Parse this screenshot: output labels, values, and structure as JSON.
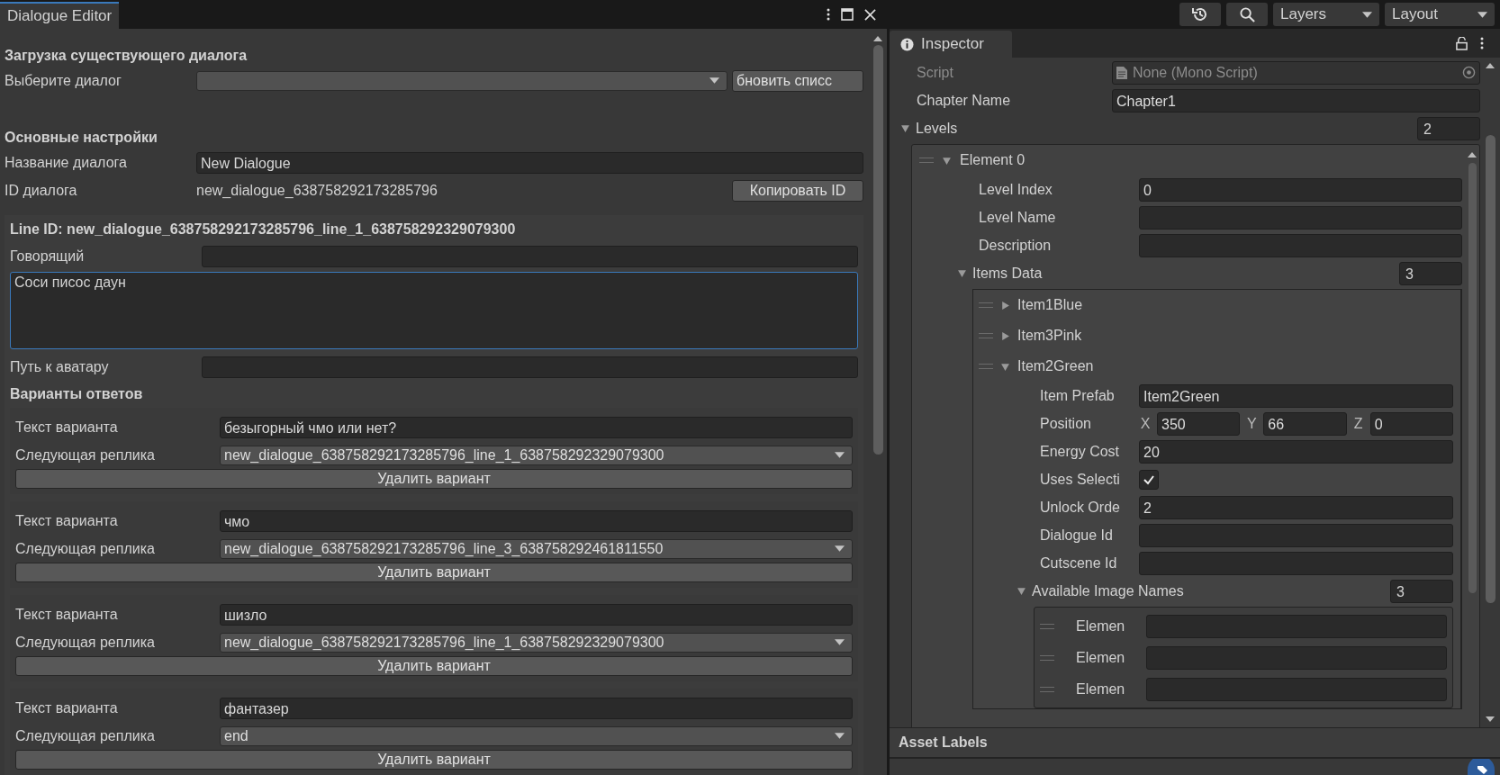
{
  "dialogue_editor": {
    "tab": "Dialogue Editor",
    "load": {
      "heading": "Загрузка существующего диалога",
      "select_label": "Выберите диалог",
      "refresh_button": "бновить списс"
    },
    "settings": {
      "heading": "Основные настройки",
      "name_label": "Название диалога",
      "name_value": "New Dialogue",
      "id_label": "ID диалога",
      "id_value": "new_dialogue_638758292173285796",
      "copy_button": "Копировать ID"
    },
    "line": {
      "title": "Line ID: new_dialogue_638758292173285796_line_1_638758292329079300",
      "speaker_label": "Говорящий",
      "text": "Соси писос даун",
      "avatar_label": "Путь к аватару",
      "variants_heading": "Варианты ответов",
      "variants": [
        {
          "text_label": "Текст варианта",
          "text": "безыгорный чмо или нет?",
          "next_label": "Следующая реплика",
          "next": "new_dialogue_638758292173285796_line_1_638758292329079300",
          "delete_button": "Удалить вариант"
        },
        {
          "text_label": "Текст варианта",
          "text": "чмо",
          "next_label": "Следующая реплика",
          "next": "new_dialogue_638758292173285796_line_3_638758292461811550",
          "delete_button": "Удалить вариант"
        },
        {
          "text_label": "Текст варианта",
          "text": "шизло",
          "next_label": "Следующая реплика",
          "next": "new_dialogue_638758292173285796_line_1_638758292329079300",
          "delete_button": "Удалить вариант"
        },
        {
          "text_label": "Текст варианта",
          "text": "фантазер",
          "next_label": "Следующая реплика",
          "next": "end",
          "delete_button": "Удалить вариант"
        }
      ]
    }
  },
  "toolbar": {
    "layers": "Layers",
    "layout": "Layout"
  },
  "inspector": {
    "tab": "Inspector",
    "script": {
      "label": "Script",
      "value": "None (Mono Script)"
    },
    "chapter": {
      "label": "Chapter Name",
      "value": "Chapter1"
    },
    "levels": {
      "label": "Levels",
      "count": "2",
      "expanded": true,
      "elements": [
        {
          "label": "Element 0",
          "expanded": true,
          "fields": [
            {
              "label": "Level Index",
              "value": "0"
            },
            {
              "label": "Level Name"
            },
            {
              "label": "Description"
            }
          ],
          "items_data": {
            "label": "Items Data",
            "count": "3",
            "expanded": true,
            "items": [
              {
                "name": "Item1Blue",
                "expanded": false
              },
              {
                "name": "Item3Pink",
                "expanded": false
              },
              {
                "name": "Item2Green",
                "expanded": true,
                "fields": [
                  {
                    "kind": "text",
                    "label": "Item Prefab",
                    "value": "Item2Green"
                  },
                  {
                    "kind": "vector",
                    "label": "Position",
                    "components": [
                      {
                        "axis": "X",
                        "value": "350"
                      },
                      {
                        "axis": "Y",
                        "value": "66"
                      },
                      {
                        "axis": "Z",
                        "value": "0"
                      }
                    ]
                  },
                  {
                    "kind": "text",
                    "label": "Energy Cost",
                    "value": "20"
                  },
                  {
                    "kind": "checkbox",
                    "label": "Uses Selecti",
                    "checked": true
                  },
                  {
                    "kind": "text",
                    "label": "Unlock Orde",
                    "value": "2"
                  },
                  {
                    "kind": "text",
                    "label": "Dialogue Id"
                  },
                  {
                    "kind": "text",
                    "label": "Cutscene Id"
                  },
                  {
                    "kind": "list",
                    "label": "Available Image Names",
                    "count": "3",
                    "expanded": true,
                    "elements": [
                      {
                        "label": "Elemen"
                      },
                      {
                        "label": "Elemen"
                      },
                      {
                        "label": "Elemen"
                      }
                    ]
                  }
                ]
              }
            ]
          }
        }
      ]
    },
    "asset_labels": "Asset Labels"
  }
}
